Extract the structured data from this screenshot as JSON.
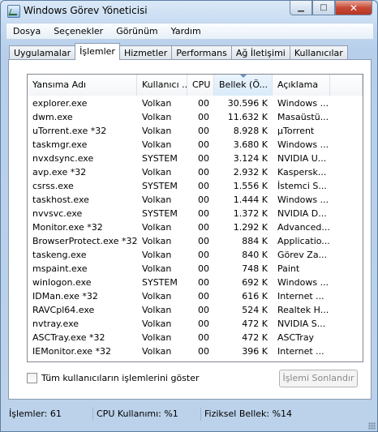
{
  "window": {
    "title": "Windows Görev Yöneticisi"
  },
  "menu": [
    "Dosya",
    "Seçenekler",
    "Görünüm",
    "Yardım"
  ],
  "tabs": [
    "Uygulamalar",
    "İşlemler",
    "Hizmetler",
    "Performans",
    "Ağ İletişimi",
    "Kullanıcılar"
  ],
  "active_tab": "İşlemler",
  "columns": [
    "Yansıma Adı",
    "Kullanıcı ...",
    "CPU",
    "Bellek (Ö...",
    "Açıklama"
  ],
  "rows": [
    [
      "explorer.exe",
      "Volkan",
      "00",
      "30.596 K",
      "Windows ..."
    ],
    [
      "dwm.exe",
      "Volkan",
      "00",
      "11.632 K",
      "Masaüstü..."
    ],
    [
      "uTorrent.exe *32",
      "Volkan",
      "00",
      "8.928 K",
      "µTorrent"
    ],
    [
      "taskmgr.exe",
      "Volkan",
      "00",
      "3.680 K",
      "Windows ..."
    ],
    [
      "nvxdsync.exe",
      "SYSTEM",
      "00",
      "3.124 K",
      "NVIDIA U..."
    ],
    [
      "avp.exe *32",
      "Volkan",
      "00",
      "2.932 K",
      "Kaspersk..."
    ],
    [
      "csrss.exe",
      "SYSTEM",
      "00",
      "1.556 K",
      "İstemci S..."
    ],
    [
      "taskhost.exe",
      "Volkan",
      "00",
      "1.444 K",
      "Windows ..."
    ],
    [
      "nvvsvc.exe",
      "SYSTEM",
      "00",
      "1.372 K",
      "NVIDIA D..."
    ],
    [
      "Monitor.exe *32",
      "Volkan",
      "00",
      "1.292 K",
      "Advanced..."
    ],
    [
      "BrowserProtect.exe *32",
      "Volkan",
      "00",
      "884 K",
      "Applicatio..."
    ],
    [
      "taskeng.exe",
      "Volkan",
      "00",
      "840 K",
      "Görev Za..."
    ],
    [
      "mspaint.exe",
      "Volkan",
      "00",
      "748 K",
      "Paint"
    ],
    [
      "winlogon.exe",
      "SYSTEM",
      "00",
      "692 K",
      "Windows ..."
    ],
    [
      "IDMan.exe *32",
      "Volkan",
      "00",
      "616 K",
      "Internet ..."
    ],
    [
      "RAVCpl64.exe",
      "Volkan",
      "00",
      "524 K",
      "Realtek H..."
    ],
    [
      "nvtray.exe",
      "Volkan",
      "00",
      "472 K",
      "NVIDIA S..."
    ],
    [
      "ASCTray.exe *32",
      "Volkan",
      "00",
      "472 K",
      "ASCTray"
    ],
    [
      "IEMonitor.exe *32",
      "Volkan",
      "00",
      "396 K",
      "Internet ..."
    ]
  ],
  "show_all_label": "Tüm kullanıcıların işlemlerini göster",
  "show_all_checked": false,
  "end_process_label": "İşlemi Sonlandır",
  "status": {
    "processes": "İşlemler: 61",
    "cpu": "CPU Kullanımı: %1",
    "memory": "Fiziksel Bellek: %14"
  }
}
